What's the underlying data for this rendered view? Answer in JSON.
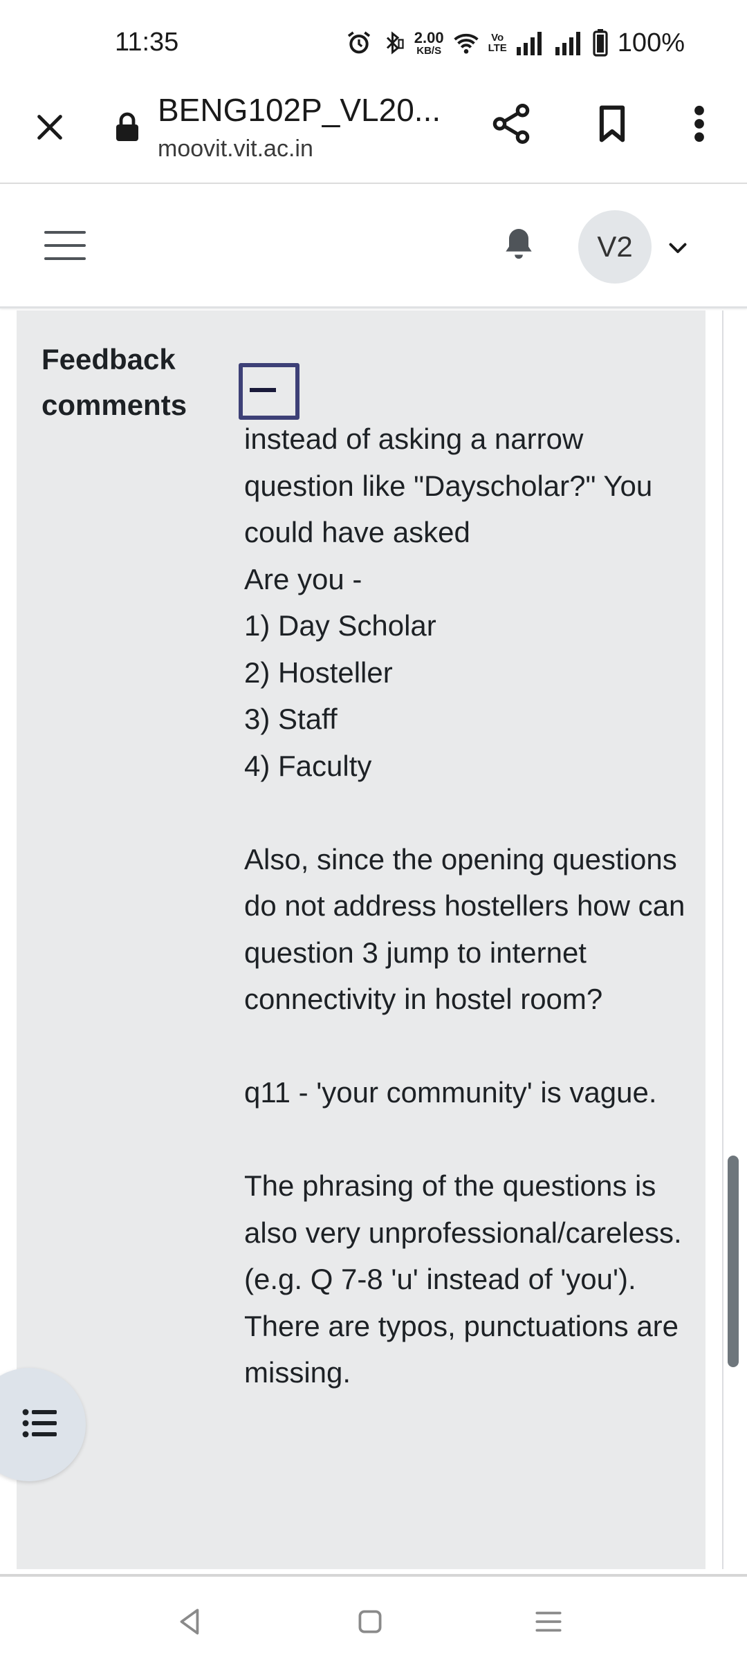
{
  "status_bar": {
    "time": "11:35",
    "net_speed_value": "2.00",
    "net_speed_unit": "KB/S",
    "volte_top": "Vo",
    "volte_bottom": "LTE",
    "battery": "100%"
  },
  "browser": {
    "title": "BENG102P_VL20...",
    "url": "moovit.vit.ac.in",
    "icons": [
      "close-icon",
      "lock-icon",
      "share-icon",
      "bookmark-icon",
      "more-vert-icon"
    ]
  },
  "site_nav": {
    "avatar_initials": "V2",
    "icons": [
      "hamburger-menu-icon",
      "notification-bell-icon",
      "chevron-down-icon"
    ]
  },
  "feedback": {
    "label": "Feedback comments",
    "lines": [
      "instead of asking a narrow question like \"Dayscholar?\" You could have asked",
      "Are you -",
      "1) Day Scholar",
      "2) Hosteller",
      "3) Staff",
      "4) Faculty",
      "",
      "Also, since the opening questions do not address hostellers how can question 3 jump to internet connectivity in hostel room?",
      "",
      "q11 - 'your community' is vague.",
      "",
      "The phrasing of the questions is also very unprofessional/careless. (e.g. Q 7-8 'u' instead of 'you'). There are typos, punctuations are missing."
    ]
  },
  "colors": {
    "panel_bg": "#e9eaeb",
    "toggle_border": "#3d4077",
    "avatar_bg": "#e3e6e9",
    "toc_bg": "#dde3ea"
  },
  "android_nav": {
    "icons": [
      "back-icon",
      "home-icon",
      "recents-icon"
    ]
  }
}
